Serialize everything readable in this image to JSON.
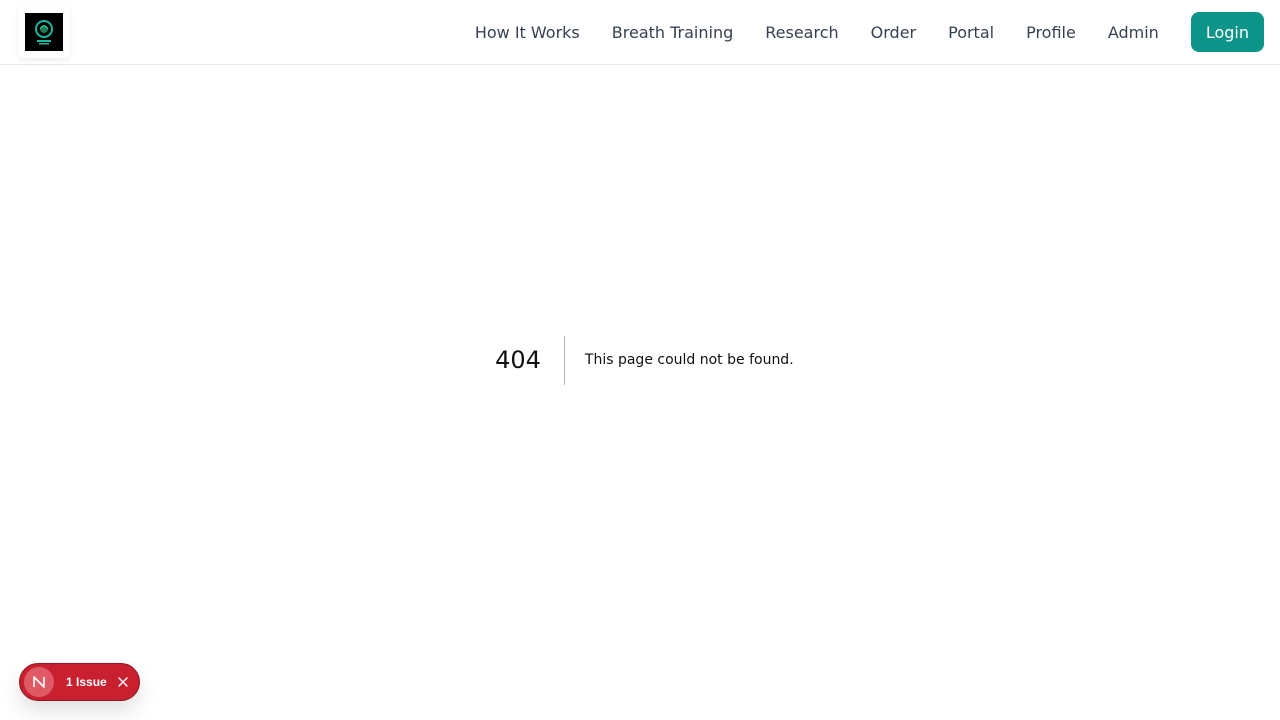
{
  "colors": {
    "accent": "#0d9488",
    "nav_text": "#374151",
    "issue_bg": "#c8202f"
  },
  "header": {
    "logo_icon": "brand-logo-icon",
    "nav": [
      {
        "label": "How It Works"
      },
      {
        "label": "Breath Training"
      },
      {
        "label": "Research"
      },
      {
        "label": "Order"
      },
      {
        "label": "Portal"
      },
      {
        "label": "Profile"
      },
      {
        "label": "Admin"
      }
    ],
    "login_label": "Login"
  },
  "main": {
    "code": "404",
    "message": "This page could not be found."
  },
  "dev_overlay": {
    "badge_letter": "N",
    "issue_label": "1 Issue",
    "close_icon": "close-icon"
  }
}
